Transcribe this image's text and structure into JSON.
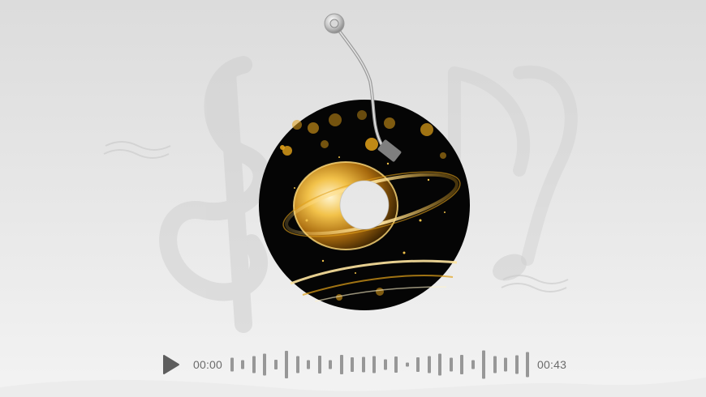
{
  "player": {
    "current_time": "00:00",
    "duration": "00:43",
    "play_icon": "play-icon",
    "progress": 0
  },
  "waveform": {
    "levels": [
      0.45,
      0.3,
      0.55,
      0.7,
      0.32,
      0.9,
      0.55,
      0.28,
      0.58,
      0.3,
      0.62,
      0.48,
      0.5,
      0.55,
      0.35,
      0.52,
      0.12,
      0.48,
      0.55,
      0.7,
      0.45,
      0.62,
      0.3,
      0.92,
      0.55,
      0.45,
      0.6,
      0.82
    ],
    "color": "#979797"
  },
  "colors": {
    "accent_gold": "#e3a21a",
    "disc_black": "#050505",
    "icon_gray": "#5e5e5e",
    "text_gray": "#6b6b6b"
  }
}
